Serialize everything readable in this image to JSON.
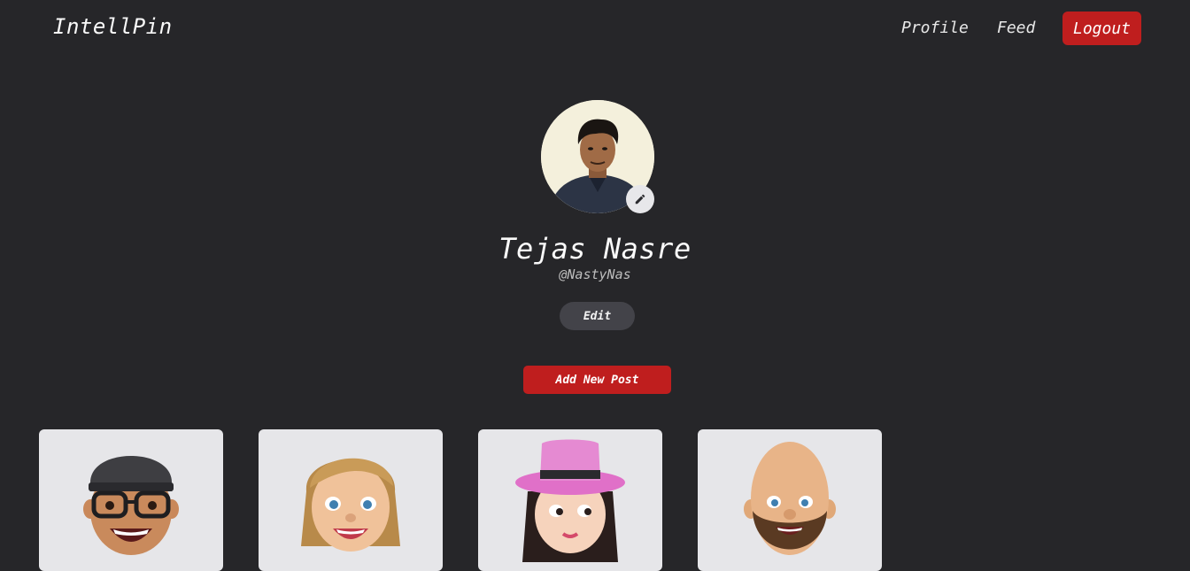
{
  "nav": {
    "brand": "IntellPin",
    "links": [
      "Profile",
      "Feed"
    ],
    "logout_label": "Logout"
  },
  "profile": {
    "name": "Tejas Nasre",
    "handle": "@NastyNas",
    "edit_label": "Edit",
    "add_post_label": "Add New Post"
  },
  "colors": {
    "background": "#262629",
    "accent": "#bf1e1e",
    "card": "#e6e6e9"
  },
  "icons": {
    "edit_picture": "pencil-icon"
  },
  "posts": [
    {
      "image": "memoji-cap-glasses"
    },
    {
      "image": "memoji-blonde-woman"
    },
    {
      "image": "memoji-pink-hat-girl"
    },
    {
      "image": "memoji-bald-beard"
    }
  ]
}
